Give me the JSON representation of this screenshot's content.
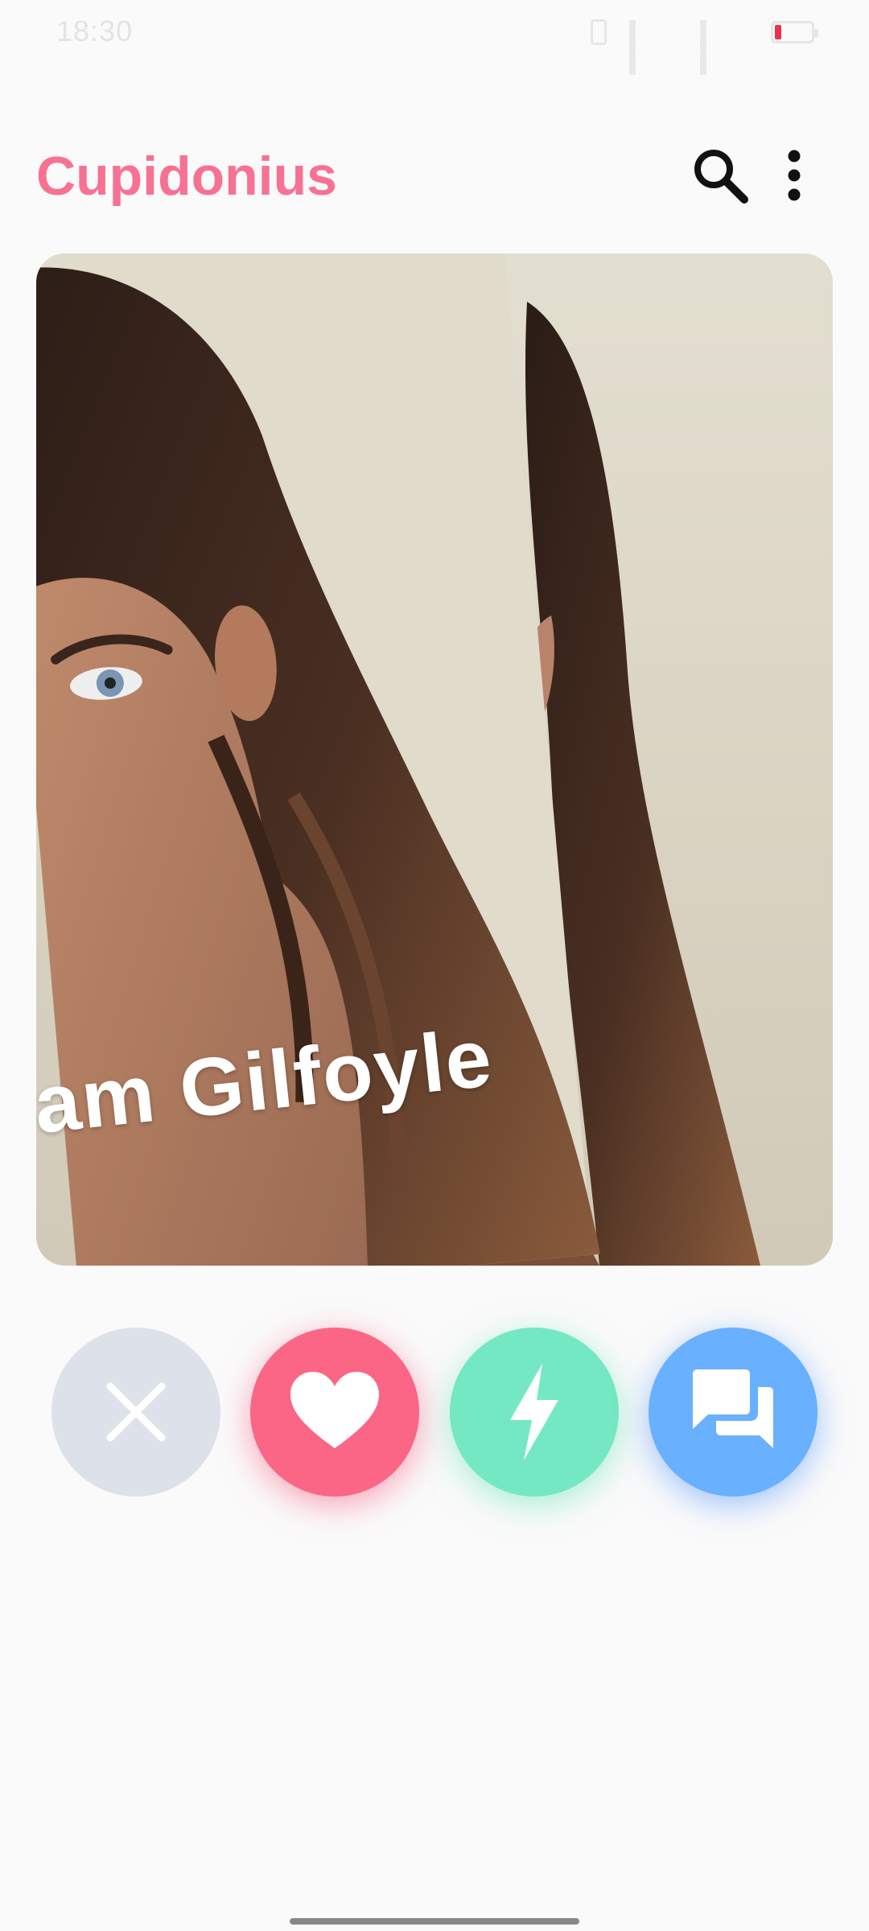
{
  "status_bar": {
    "time": "18:30",
    "icons": [
      "vibrate-icon",
      "wifi-signal-icon",
      "cell-signal-icon",
      "battery-icon"
    ],
    "battery_color": "#e8314a"
  },
  "header": {
    "title": "Cupidonius",
    "title_color": "#f77292",
    "search_icon": "search-icon",
    "menu_icon": "more-vert-icon"
  },
  "card": {
    "name": "Liam Gilfoyle",
    "photo_description": "profile-photo"
  },
  "actions": [
    {
      "id": "dislike",
      "icon": "close-icon",
      "color": "#dde2ea"
    },
    {
      "id": "like",
      "icon": "heart-icon",
      "color": "#fb6686"
    },
    {
      "id": "boost",
      "icon": "lightning-icon",
      "color": "#74e8c2"
    },
    {
      "id": "chat",
      "icon": "chat-icon",
      "color": "#69b0ff"
    }
  ]
}
